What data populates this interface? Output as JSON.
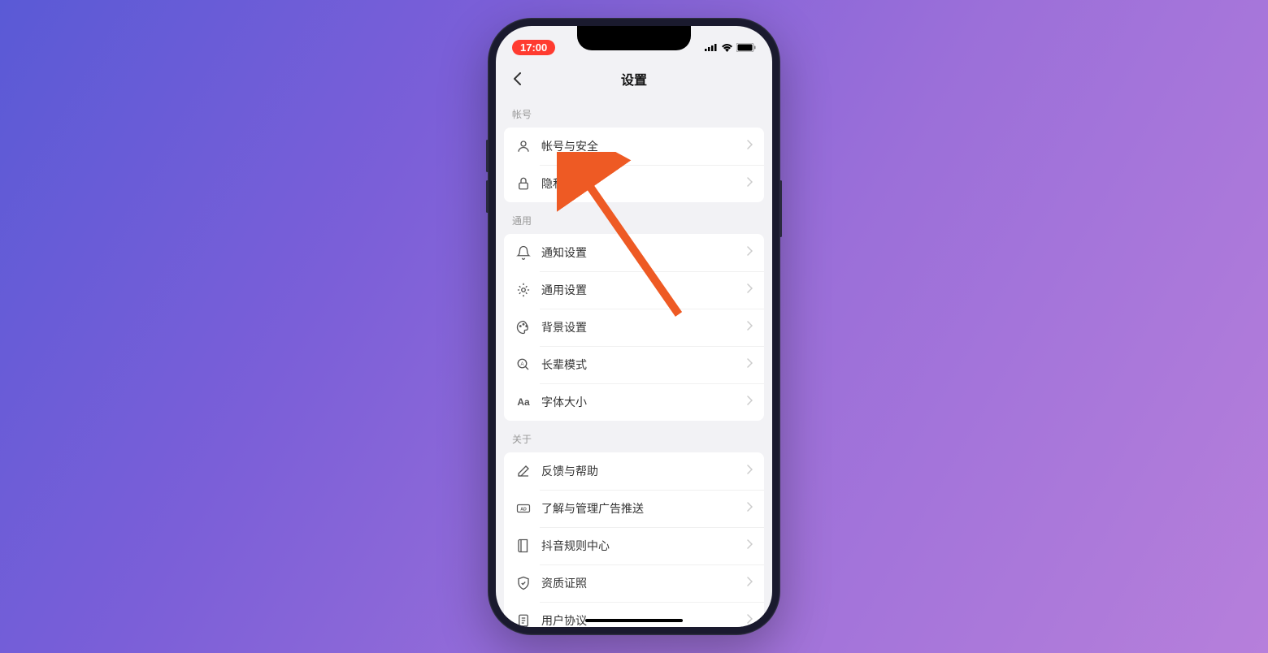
{
  "status": {
    "time": "17:00"
  },
  "nav": {
    "title": "设置"
  },
  "sections": {
    "account": {
      "header": "帐号",
      "items": [
        {
          "label": "帐号与安全"
        },
        {
          "label": "隐私设置"
        }
      ]
    },
    "general": {
      "header": "通用",
      "items": [
        {
          "label": "通知设置"
        },
        {
          "label": "通用设置"
        },
        {
          "label": "背景设置"
        },
        {
          "label": "长辈模式"
        },
        {
          "label": "字体大小"
        }
      ]
    },
    "about": {
      "header": "关于",
      "items": [
        {
          "label": "反馈与帮助"
        },
        {
          "label": "了解与管理广告推送"
        },
        {
          "label": "抖音规则中心"
        },
        {
          "label": "资质证照"
        },
        {
          "label": "用户协议"
        }
      ]
    }
  }
}
